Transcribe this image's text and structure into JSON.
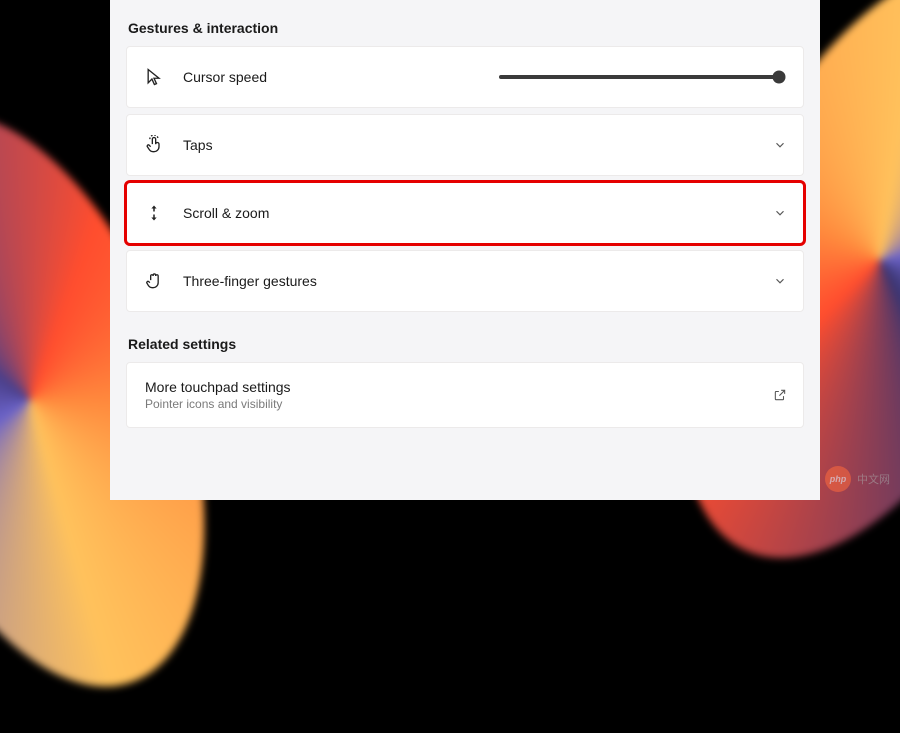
{
  "sections": {
    "gestures": {
      "header": "Gestures & interaction",
      "items": {
        "cursor_speed": {
          "label": "Cursor speed",
          "slider_value": 100
        },
        "taps": {
          "label": "Taps"
        },
        "scroll_zoom": {
          "label": "Scroll & zoom"
        },
        "three_finger": {
          "label": "Three-finger gestures"
        }
      }
    },
    "related": {
      "header": "Related settings",
      "items": {
        "more_touchpad": {
          "label": "More touchpad settings",
          "sub": "Pointer icons and visibility"
        }
      }
    }
  },
  "watermark": {
    "badge": "php",
    "text": "中文网"
  }
}
